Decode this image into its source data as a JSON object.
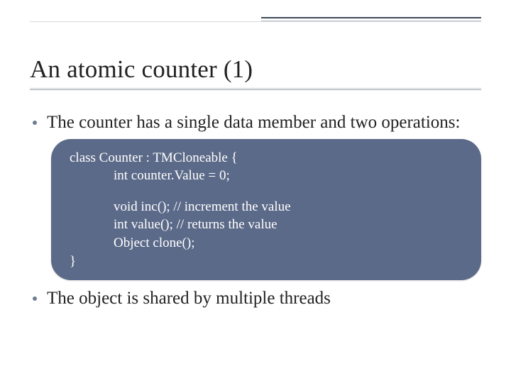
{
  "title": "An atomic counter (1)",
  "bullets": [
    "The counter has a single data member and two operations:",
    "The object is shared by multiple threads"
  ],
  "code": {
    "l1": "class Counter : TMCloneable {",
    "l2": "int counter.Value = 0;",
    "l3": "void inc(); // increment the value",
    "l4": "int value(); // returns the value",
    "l5": "Object clone();",
    "l6": "}"
  }
}
